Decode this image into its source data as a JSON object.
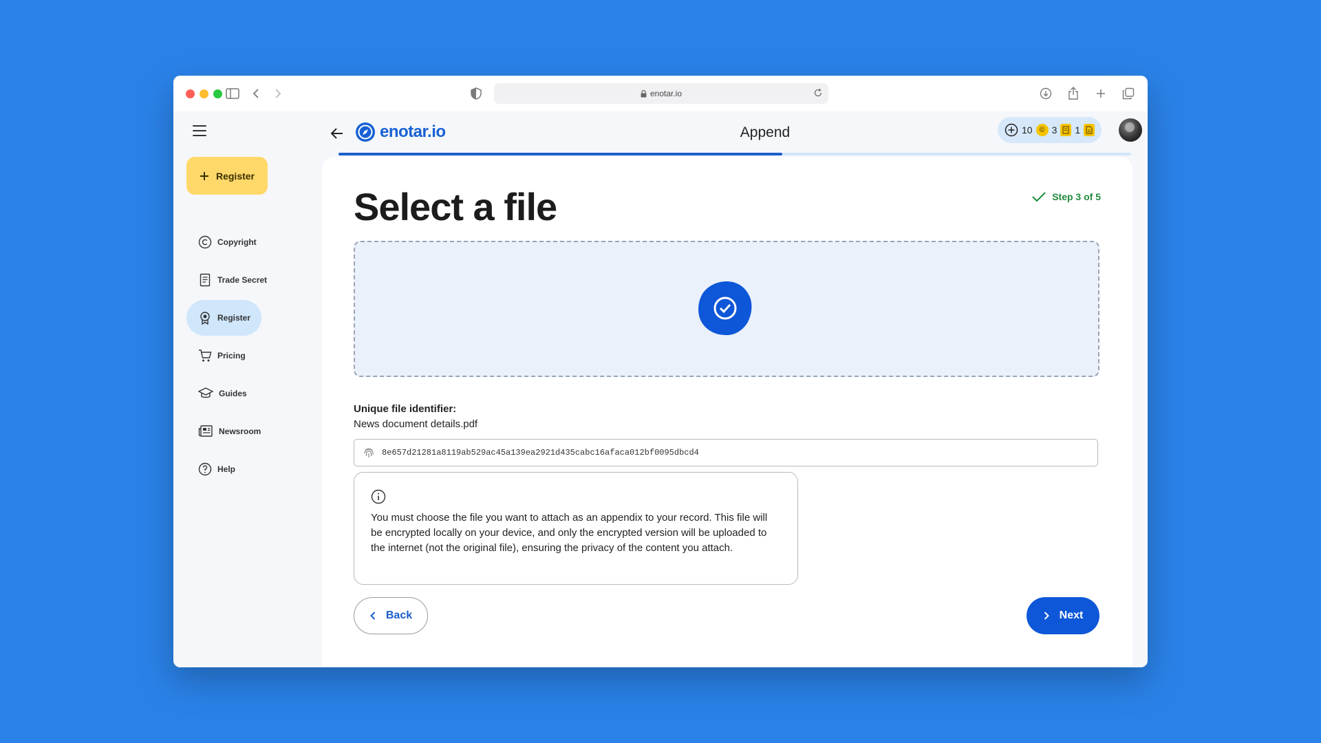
{
  "browser": {
    "url": "enotar.io"
  },
  "app": {
    "brand": "enotar.io",
    "page_title": "Append",
    "counters": {
      "credits": "10",
      "copyright": "3",
      "trade_secret": "1"
    },
    "progress": 0.56
  },
  "sidebar": {
    "register_button": "Register",
    "items": [
      {
        "label": "Copyright",
        "icon": "copyright-icon"
      },
      {
        "label": "Trade Secret",
        "icon": "document-icon"
      },
      {
        "label": "Register",
        "icon": "award-icon",
        "active": true
      },
      {
        "label": "Pricing",
        "icon": "cart-icon"
      },
      {
        "label": "Guides",
        "icon": "graduation-cap-icon"
      },
      {
        "label": "Newsroom",
        "icon": "newspaper-icon"
      },
      {
        "label": "Help",
        "icon": "help-icon"
      }
    ]
  },
  "main": {
    "title": "Select a file",
    "step": "Step 3 of 5",
    "uid_label": "Unique file identifier:",
    "file_name": "News document details.pdf",
    "hash": "8e657d21281a8119ab529ac45a139ea2921d435cabc16afaca012bf0095dbcd4",
    "info_text": "You must choose the file you want to attach as an appendix to your record. This file will be encrypted locally on your device, and only the encrypted version will be uploaded to the internet (not the original file), ensuring the privacy of the content you attach.",
    "back_label": "Back",
    "next_label": "Next"
  },
  "colors": {
    "accent": "#0d57d8",
    "register_button": "#ffd86a",
    "active_nav": "#cfe6fb",
    "success": "#1e8a3a",
    "background": "#2a82e8"
  }
}
